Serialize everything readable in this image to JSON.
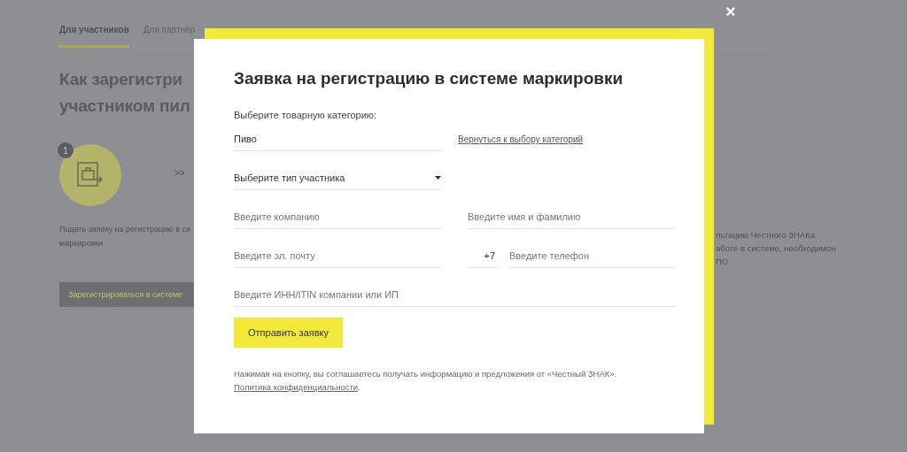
{
  "page": {
    "tabs": [
      {
        "label": "Для участников",
        "selected": true
      },
      {
        "label": "Для партнёр",
        "selected": false
      }
    ],
    "heading_lines": [
      "Как зарегистри",
      "участником пил"
    ],
    "step": {
      "number": "1",
      "text_lines": [
        "Подать заявку на регистрацию в си",
        "маркировки"
      ],
      "arrow": ">>"
    },
    "right_text_lines": [
      "льтацию Честного ЗНАКа",
      "аботе в системе, необходимон",
      "ПО"
    ],
    "register_button": "Зарегистрироваться в системе"
  },
  "modal": {
    "close": "×",
    "title": "Заявка на регистрацию в системе маркировки",
    "category_label": "Выберите товарную категорию:",
    "category": {
      "value": "Пиво"
    },
    "back_link": "Вернуться к выбору категорий",
    "participant_type": {
      "placeholder": "Выберите тип участника"
    },
    "company": {
      "placeholder": "Введите компанию"
    },
    "name": {
      "placeholder": "Введите имя и фамилию"
    },
    "email": {
      "placeholder": "Введите эл. почту"
    },
    "phone_code": {
      "value": "+7"
    },
    "phone": {
      "placeholder": "Введите телефон"
    },
    "inn": {
      "placeholder": "Введите ИНН/ITIN компании или ИП"
    },
    "submit": "Отправить заявку",
    "disclaimer": "Нажимая на кнопку, вы соглашаетесь получать информацию и предложения от «Честный ЗНАК».",
    "policy_link": "Политика конфиденциальности",
    "disclaimer_end": "."
  }
}
